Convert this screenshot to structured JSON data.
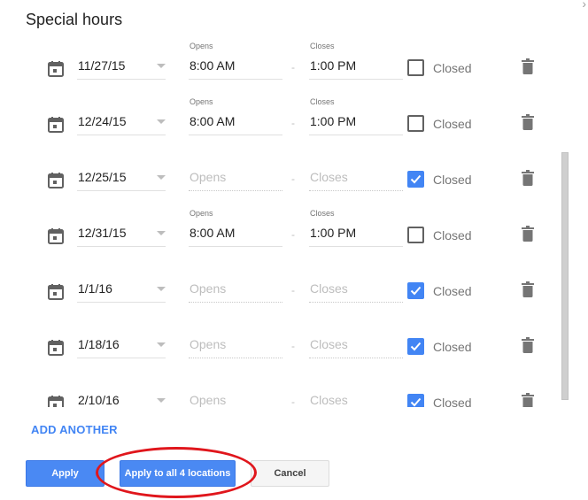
{
  "dialog": {
    "title": "Special hours",
    "close_glyph": "›"
  },
  "labels": {
    "opens": "Opens",
    "closes": "Closes",
    "closed": "Closed",
    "dash": "-"
  },
  "rows": [
    {
      "date": "11/27/15",
      "opens": "8:00 AM",
      "closes": "1:00 PM",
      "closed": false,
      "partially_visible": true
    },
    {
      "date": "12/24/15",
      "opens": "8:00 AM",
      "closes": "1:00 PM",
      "closed": false
    },
    {
      "date": "12/25/15",
      "opens": "",
      "closes": "",
      "closed": true
    },
    {
      "date": "12/31/15",
      "opens": "8:00 AM",
      "closes": "1:00 PM",
      "closed": false
    },
    {
      "date": "1/1/16",
      "opens": "",
      "closes": "",
      "closed": true
    },
    {
      "date": "1/18/16",
      "opens": "",
      "closes": "",
      "closed": true
    },
    {
      "date": "2/10/16",
      "opens": "",
      "closes": "",
      "closed": true
    }
  ],
  "actions": {
    "add_another": "ADD ANOTHER",
    "apply": "Apply",
    "apply_all": "Apply to all 4 locations",
    "cancel": "Cancel"
  },
  "colors": {
    "accent": "#4285f4",
    "annotation": "#e0161c"
  }
}
